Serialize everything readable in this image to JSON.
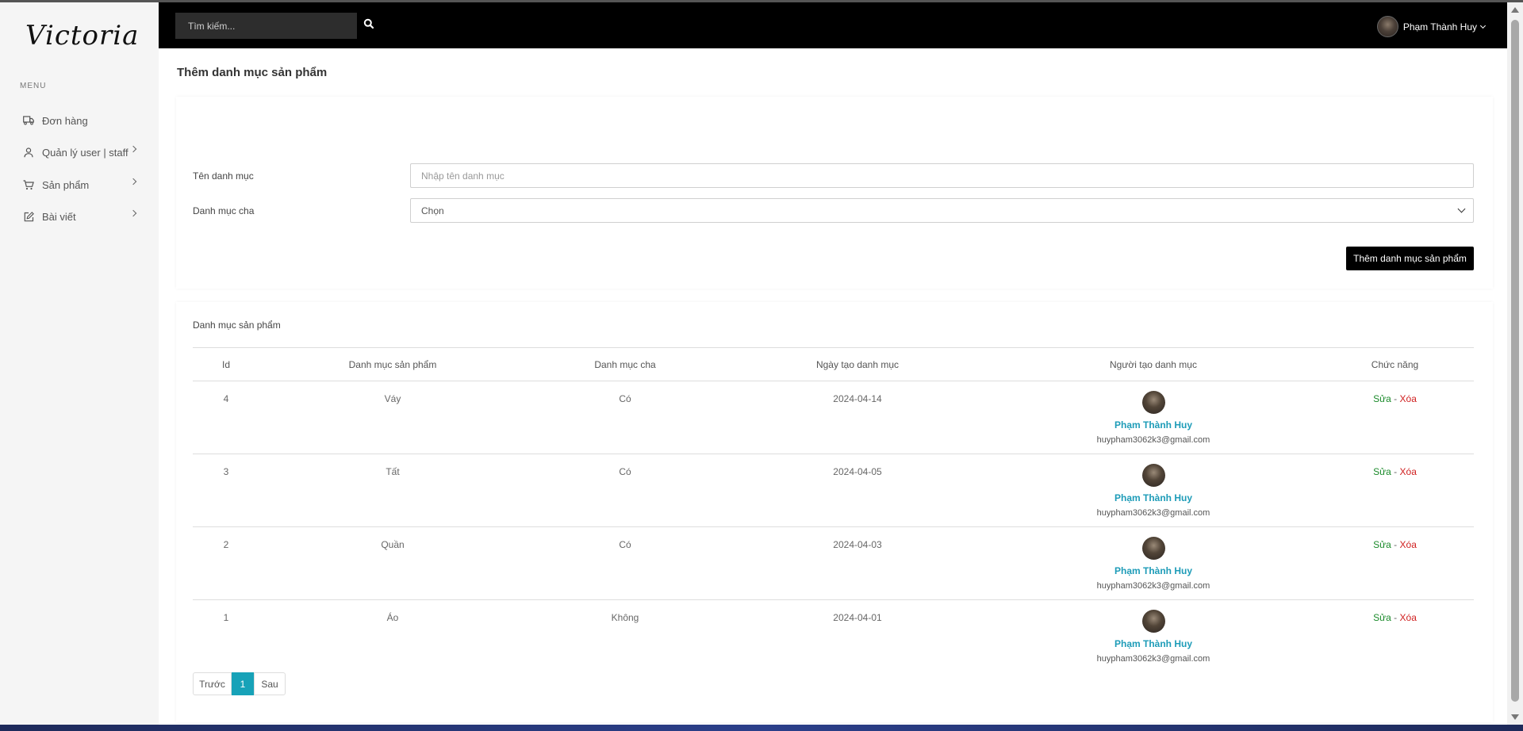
{
  "brand": {
    "logo": "Victoria"
  },
  "sidebar": {
    "menu_title": "MENU",
    "items": [
      {
        "label": "Đơn hàng",
        "icon": "truck-icon",
        "has_submenu": false
      },
      {
        "label": "Quản lý user | staff",
        "icon": "user-icon",
        "has_submenu": true
      },
      {
        "label": "Sản phẩm",
        "icon": "cart-icon",
        "has_submenu": true
      },
      {
        "label": "Bài viết",
        "icon": "edit-icon",
        "has_submenu": true
      }
    ]
  },
  "topbar": {
    "search_placeholder": "Tìm kiếm...",
    "user_name": "Phạm Thành Huy"
  },
  "form": {
    "page_title": "Thêm danh mục sản phẩm",
    "name_label": "Tên danh mục",
    "name_placeholder": "Nhập tên danh mục",
    "parent_label": "Danh mục cha",
    "parent_selected": "Chọn",
    "submit_label": "Thêm danh mục sản phẩm"
  },
  "table": {
    "title": "Danh mục sản phẩm",
    "headers": [
      "Id",
      "Danh mục sản phẩm",
      "Danh mục cha",
      "Ngày tạo danh mục",
      "Người tạo danh mục",
      "Chức năng"
    ],
    "rows": [
      {
        "id": "4",
        "name": "Váy",
        "parent": "Có",
        "created": "2024-04-14",
        "creator_name": "Phạm Thành Huy",
        "creator_email": "huypham3062k3@gmail.com",
        "edit": "Sửa",
        "sep": "-",
        "delete": "Xóa"
      },
      {
        "id": "3",
        "name": "Tất",
        "parent": "Có",
        "created": "2024-04-05",
        "creator_name": "Phạm Thành Huy",
        "creator_email": "huypham3062k3@gmail.com",
        "edit": "Sửa",
        "sep": "-",
        "delete": "Xóa"
      },
      {
        "id": "2",
        "name": "Quần",
        "parent": "Có",
        "created": "2024-04-03",
        "creator_name": "Phạm Thành Huy",
        "creator_email": "huypham3062k3@gmail.com",
        "edit": "Sửa",
        "sep": "-",
        "delete": "Xóa"
      },
      {
        "id": "1",
        "name": "Áo",
        "parent": "Không",
        "created": "2024-04-01",
        "creator_name": "Phạm Thành Huy",
        "creator_email": "huypham3062k3@gmail.com",
        "edit": "Sửa",
        "sep": "-",
        "delete": "Xóa"
      }
    ]
  },
  "pagination": {
    "prev": "Trước",
    "current": "1",
    "next": "Sau"
  },
  "colors": {
    "accent": "#17a2b8",
    "edit": "#1a8a2a",
    "delete": "#d02020",
    "topbar": "#000000"
  }
}
